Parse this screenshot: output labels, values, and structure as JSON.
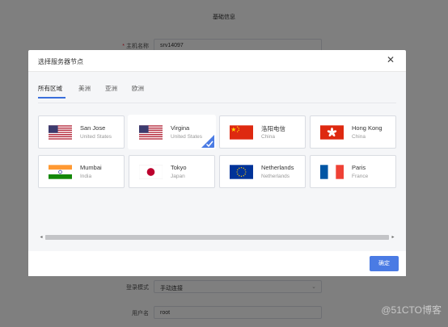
{
  "background": {
    "section_title": "基础信息",
    "fields": [
      {
        "label": "主机名称",
        "required": true,
        "value": "srv14097"
      },
      {
        "label": "登录模式",
        "required": false,
        "value": "手动连接"
      },
      {
        "label": "用户名",
        "required": false,
        "value": "root"
      }
    ]
  },
  "dialog": {
    "title": "选择服务器节点",
    "close_glyph": "✕",
    "tabs": [
      {
        "label": "所有区域",
        "active": true
      },
      {
        "label": "美洲",
        "active": false
      },
      {
        "label": "亚洲",
        "active": false
      },
      {
        "label": "欧洲",
        "active": false
      }
    ],
    "nodes": [
      {
        "city": "San Jose",
        "country": "United States",
        "flag": "us-flag-icon",
        "selected": false
      },
      {
        "city": "Virgina",
        "country": "United States",
        "flag": "us-flag-icon",
        "selected": true
      },
      {
        "city": "洛阳电信",
        "country": "China",
        "flag": "china-flag-icon",
        "selected": false
      },
      {
        "city": "Hong Kong",
        "country": "China",
        "flag": "hong-kong-flag-icon",
        "selected": false
      },
      {
        "city": "Mumbai",
        "country": "India",
        "flag": "india-flag-icon",
        "selected": false
      },
      {
        "city": "Tokyo",
        "country": "Japan",
        "flag": "japan-flag-icon",
        "selected": false
      },
      {
        "city": "Netherlands",
        "country": "Netherlands",
        "flag": "eu-flag-icon",
        "selected": false
      },
      {
        "city": "Paris",
        "country": "France",
        "flag": "france-flag-icon",
        "selected": false
      }
    ],
    "scroll_left_glyph": "◂",
    "scroll_right_glyph": "▸",
    "confirm_label": "确定"
  },
  "watermark": "@51CTO博客",
  "colors": {
    "accent": "#4a7be4",
    "overlay": "#000000",
    "tab_underline": "#3a6fdc"
  }
}
